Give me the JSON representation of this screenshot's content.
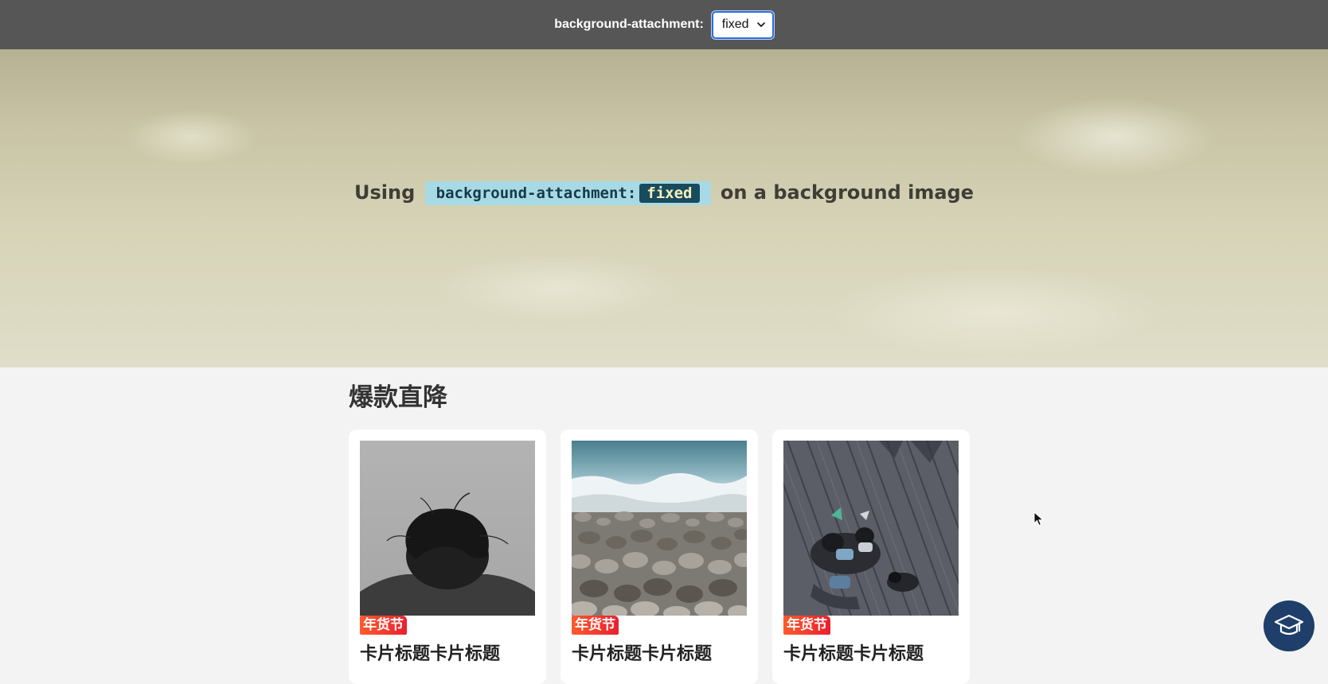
{
  "topbar": {
    "label": "background-attachment:",
    "select_value": "fixed"
  },
  "hero": {
    "prefix": "Using",
    "code_property": "background-attachment:",
    "code_value": "fixed",
    "suffix": "on a background image"
  },
  "section": {
    "title": "爆款直降"
  },
  "cards": [
    {
      "badge": "年货节",
      "title": "卡片标题卡片标题",
      "image": "woman-head-bowed-grayscale"
    },
    {
      "badge": "年货节",
      "title": "卡片标题卡片标题",
      "image": "pebble-beach-waves"
    },
    {
      "badge": "年货节",
      "title": "卡片标题卡片标题",
      "image": "people-sitting-on-boardwalk"
    }
  ],
  "icons": {
    "fab": "graduation-cap-icon",
    "select": "chevron-down-icon",
    "cursor": "mouse-pointer-icon"
  },
  "colors": {
    "topbar_bg": "#565656",
    "select_focus": "#2a6fd6",
    "code_chip_bg": "#a7dae4",
    "code_value_bg": "#194b5e",
    "badge_start": "#ff5a2d",
    "badge_end": "#e8202f",
    "fab_bg": "#1f3f6a",
    "page_bg": "#f3f3f3"
  }
}
